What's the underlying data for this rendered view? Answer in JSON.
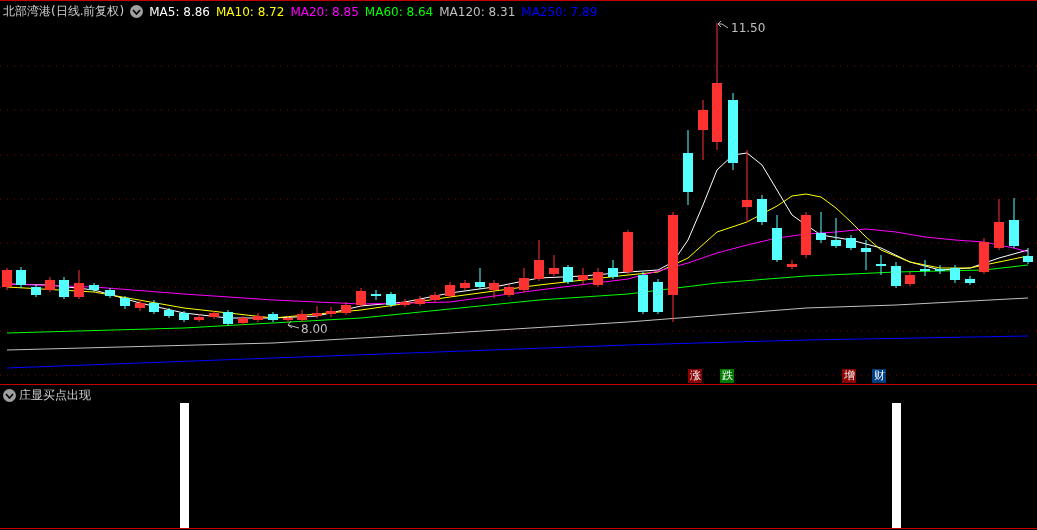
{
  "chart": {
    "title": "北部湾港(日线.前复权)",
    "moving_averages": [
      {
        "label": "MA5: 8.86",
        "color": "#ffffff"
      },
      {
        "label": "MA10: 8.72",
        "color": "#ffff00"
      },
      {
        "label": "MA20: 8.85",
        "color": "#ff00ff"
      },
      {
        "label": "MA60: 8.64",
        "color": "#00ff00"
      },
      {
        "label": "MA120: 8.31",
        "color": "#c0c0c0"
      },
      {
        "label": "MA250: 7.89",
        "color": "#0000ff"
      }
    ],
    "high_label": "11.50",
    "low_label": "8.00",
    "event_markers": [
      {
        "label": "涨",
        "color": "#8b0000"
      },
      {
        "label": "跌",
        "color": "#007a00"
      },
      {
        "label": "增",
        "color": "#8b0000"
      },
      {
        "label": "财",
        "color": "#003f7f"
      }
    ]
  },
  "indicator_panel": {
    "title": "庄显买点出现"
  }
}
